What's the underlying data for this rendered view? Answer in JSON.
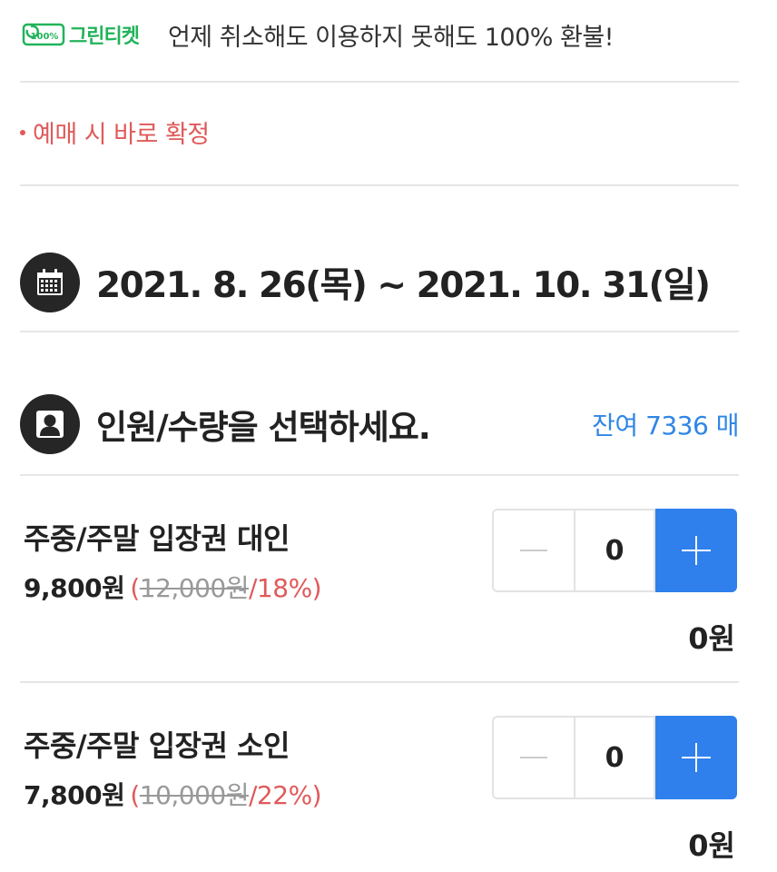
{
  "banner": {
    "logo_badge": "100%",
    "logo_text": "그린티켓",
    "message": "언제 취소해도 이용하지 못해도 100% 환불!"
  },
  "notice": {
    "text": "예매 시 바로 확정"
  },
  "period": {
    "icon": "calendar-icon",
    "text": "2021. 8. 26(목) ~ 2021. 10. 31(일)"
  },
  "quantity": {
    "icon": "person-icon",
    "title": "인원/수량을 선택하세요.",
    "remaining": "잔여 7336 매"
  },
  "items": [
    {
      "name": "주중/주말 입장권 대인",
      "price": "9,800원",
      "paren_open": "(",
      "original_price": "12,000원",
      "discount": "/18%)",
      "quantity": "0",
      "total": "0원"
    },
    {
      "name": "주중/주말 입장권 소인",
      "price": "7,800원",
      "paren_open": "(",
      "original_price": "10,000원",
      "discount": "/22%)",
      "quantity": "0",
      "total": "0원"
    }
  ],
  "colors": {
    "accent_blue": "#2f80ec",
    "discount_red": "#e05a5a",
    "brand_green": "#22b35a"
  }
}
